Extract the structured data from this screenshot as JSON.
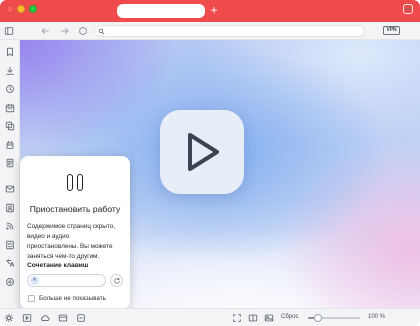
{
  "window": {
    "accent_color": "#ef4a4c"
  },
  "tabs": {
    "new_tab_label": "+",
    "menu_icon": "chevron-down-icon"
  },
  "toolbar": {
    "icons": [
      "panel-toggle-icon",
      "back-arrow-icon",
      "forward-arrow-icon",
      "reload-icon",
      "search-icon"
    ],
    "vpn_label": "VPN"
  },
  "sidebar": {
    "top_icons": [
      "bookmark-icon",
      "download-icon",
      "history-icon",
      "calendar-icon",
      "window-panel-icon",
      "reading-list-icon",
      "notes-icon"
    ],
    "bottom_icons": [
      "mail-icon",
      "contacts-icon",
      "feeds-icon",
      "tasks-icon",
      "translate-icon",
      "add-web-panel-icon"
    ]
  },
  "content": {
    "center_button_icon": "play-icon",
    "gradient_colors": [
      "#9480ee",
      "#76a8ee",
      "#f1bee4",
      "#fcfcfe"
    ]
  },
  "popup": {
    "icon": "pause-icon",
    "title": "Приостановить работу",
    "description": "Содержимое страниц скрыто, видео и аудио приостановлены. Вы можете заняться чем-то другим.",
    "shortcut_label": "Сочетание клавиш",
    "shortcut_key": "^",
    "reset_icon": "refresh-icon",
    "checkbox_label": "Больше не показывать",
    "checkbox_checked": false
  },
  "status_bar": {
    "left_icons": [
      "settings-icon",
      "panel-play-icon",
      "sync-cloud-icon",
      "window-icon",
      "capture-icon"
    ],
    "right_icons": [
      "page-capture-icon",
      "tab-tiling-icon",
      "images-icon"
    ],
    "reset_label": "Сброс",
    "zoom_slider_level": 0.2,
    "zoom_value": "100 %"
  }
}
